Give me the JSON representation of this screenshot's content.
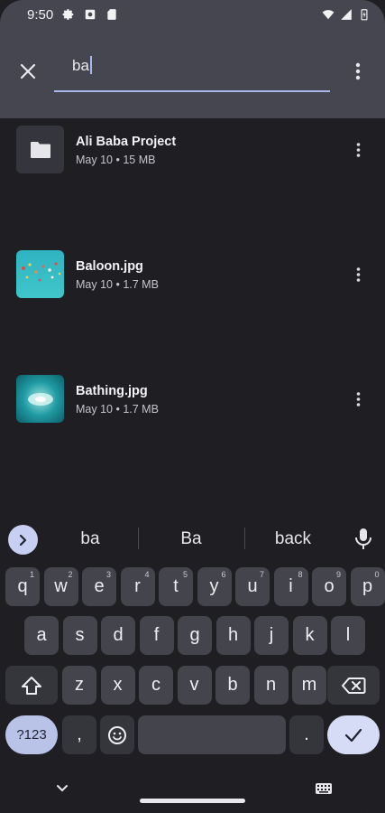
{
  "status_bar": {
    "time": "9:50",
    "icons": [
      "gear-icon",
      "camera-app-icon",
      "sd-card-icon",
      "wifi-icon",
      "signal-icon",
      "battery-charging-icon"
    ]
  },
  "search": {
    "query": "ba",
    "close_icon": "close-icon",
    "more_icon": "more-vert-icon"
  },
  "files": [
    {
      "name": "Ali Baba Project",
      "meta": "May 10 • 15 MB",
      "kind": "folder"
    },
    {
      "name": "Baloon.jpg",
      "meta": "May 10 • 1.7 MB",
      "kind": "image"
    },
    {
      "name": "Bathing.jpg",
      "meta": "May 10 • 1.7 MB",
      "kind": "image"
    }
  ],
  "keyboard": {
    "suggestions": [
      "ba",
      "Ba",
      "back"
    ],
    "row1": [
      {
        "k": "q",
        "h": "1"
      },
      {
        "k": "w",
        "h": "2"
      },
      {
        "k": "e",
        "h": "3"
      },
      {
        "k": "r",
        "h": "4"
      },
      {
        "k": "t",
        "h": "5"
      },
      {
        "k": "y",
        "h": "6"
      },
      {
        "k": "u",
        "h": "7"
      },
      {
        "k": "i",
        "h": "8"
      },
      {
        "k": "o",
        "h": "9"
      },
      {
        "k": "p",
        "h": "0"
      }
    ],
    "row2": [
      "a",
      "s",
      "d",
      "f",
      "g",
      "h",
      "j",
      "k",
      "l"
    ],
    "row3": [
      "z",
      "x",
      "c",
      "v",
      "b",
      "n",
      "m"
    ],
    "symbols_label": "?123",
    "comma_label": ",",
    "period_label": "."
  },
  "colors": {
    "header_bg": "#45464f",
    "accent": "#a9b8e8",
    "background": "#1f1f23"
  }
}
